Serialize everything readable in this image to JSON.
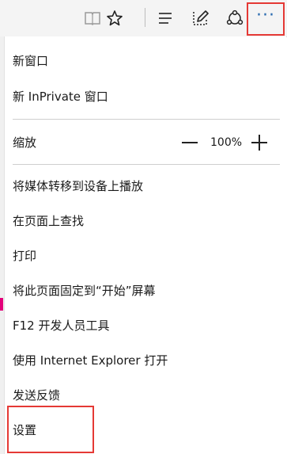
{
  "toolbar": {
    "icons": [
      "reading-view-icon",
      "favorite-star-icon",
      "hub-icon",
      "web-note-icon",
      "share-icon",
      "more-actions-icon"
    ],
    "more_label": "···",
    "highlight_color": "#e53935"
  },
  "menu": {
    "new_window": "新窗口",
    "new_inprivate_window": "新 InPrivate 窗口",
    "zoom": {
      "label": "缩放",
      "value": "100%"
    },
    "cast_media": "将媒体转移到设备上播放",
    "find_on_page": "在页面上查找",
    "print": "打印",
    "pin_to_start": "将此页面固定到“开始”屏幕",
    "f12_tools": "F12 开发人员工具",
    "open_with_ie": "使用 Internet Explorer 打开",
    "send_feedback": "发送反馈",
    "settings": "设置"
  }
}
